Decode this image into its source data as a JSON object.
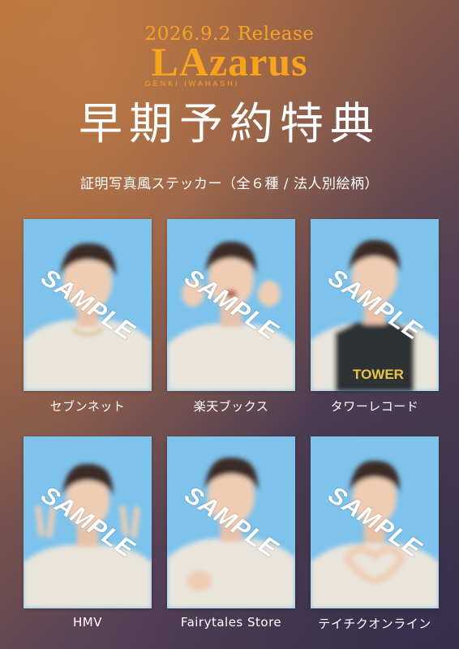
{
  "header": {
    "release": "2026.9.2 Release",
    "logo": "LAzarus",
    "artist": "GENKI IWAHASHI"
  },
  "main_title": "早期予約特典",
  "subtitle": "証明写真風ステッカー（全６種 / 法人別絵柄）",
  "watermark": "SAMPLE",
  "colors": {
    "accent": "#f7a41c",
    "photo_background": "#7ec3ec"
  },
  "cards": [
    {
      "label": "セブンネット",
      "shirt_text": ""
    },
    {
      "label": "楽天ブックス",
      "shirt_text": ""
    },
    {
      "label": "タワーレコード",
      "shirt_text": "TOWER"
    },
    {
      "label": "HMV",
      "shirt_text": ""
    },
    {
      "label": "Fairytales Store",
      "shirt_text": ""
    },
    {
      "label": "テイチクオンライン",
      "shirt_text": ""
    }
  ]
}
